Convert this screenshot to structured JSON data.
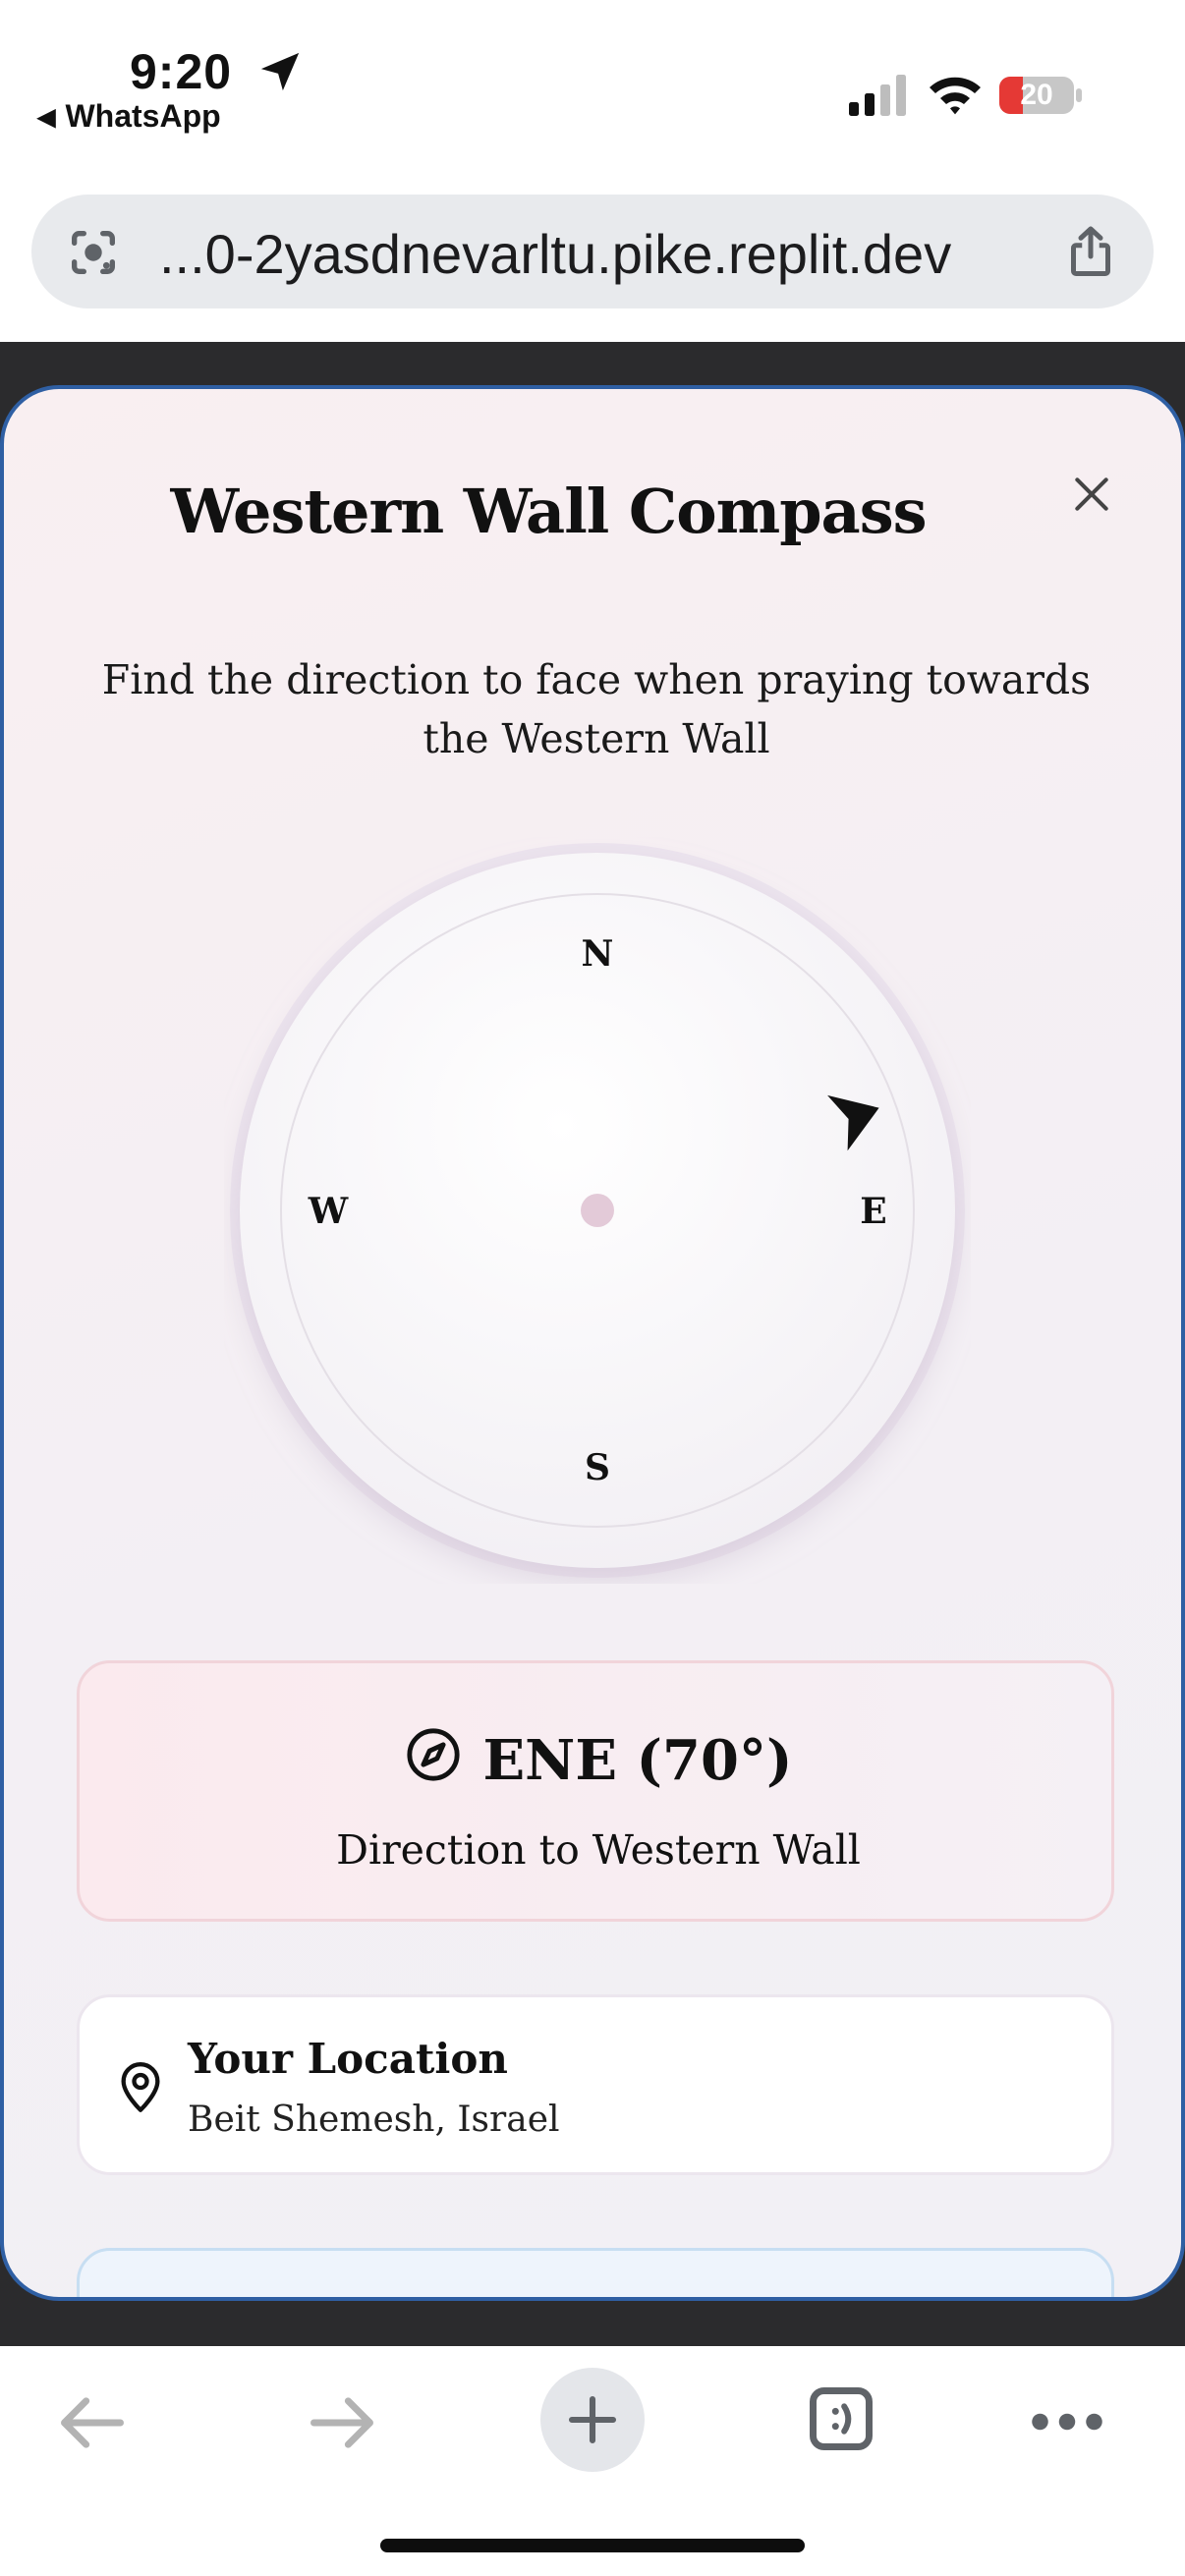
{
  "status_bar": {
    "time": "9:20",
    "back_app": "WhatsApp",
    "battery_level": "20"
  },
  "browser": {
    "url": "...0-2yasdnevarltu.pike.replit.dev"
  },
  "modal": {
    "title": "Western Wall Compass",
    "subtitle": "Find the direction to face when praying towards the Western Wall",
    "compass": {
      "labels": {
        "north": "N",
        "east": "E",
        "south": "S",
        "west": "W"
      },
      "bearing_degrees": 70
    },
    "direction": {
      "value": "ENE (70°)",
      "label": "Direction to Western Wall"
    },
    "location": {
      "title": "Your Location",
      "value": "Beit Shemesh, Israel"
    }
  },
  "colors": {
    "modal_border": "#2f5fa3",
    "needle_start": "#cfc6e6",
    "needle_end": "#ecc8d4",
    "direction_card_border": "#f1d4da",
    "battery_red": "#e53935"
  },
  "icons": {
    "location_arrow": "location-arrow-icon",
    "signal": "cellular-signal-icon",
    "wifi": "wifi-icon",
    "battery": "battery-icon",
    "lens": "google-lens-icon",
    "share": "share-icon",
    "close": "close-icon",
    "compass": "compass-icon",
    "pin": "map-pin-icon",
    "back": "back-arrow-icon",
    "forward": "forward-arrow-icon",
    "new_tab": "plus-icon",
    "tabs": "tab-switcher-icon",
    "more": "more-dots-icon"
  }
}
